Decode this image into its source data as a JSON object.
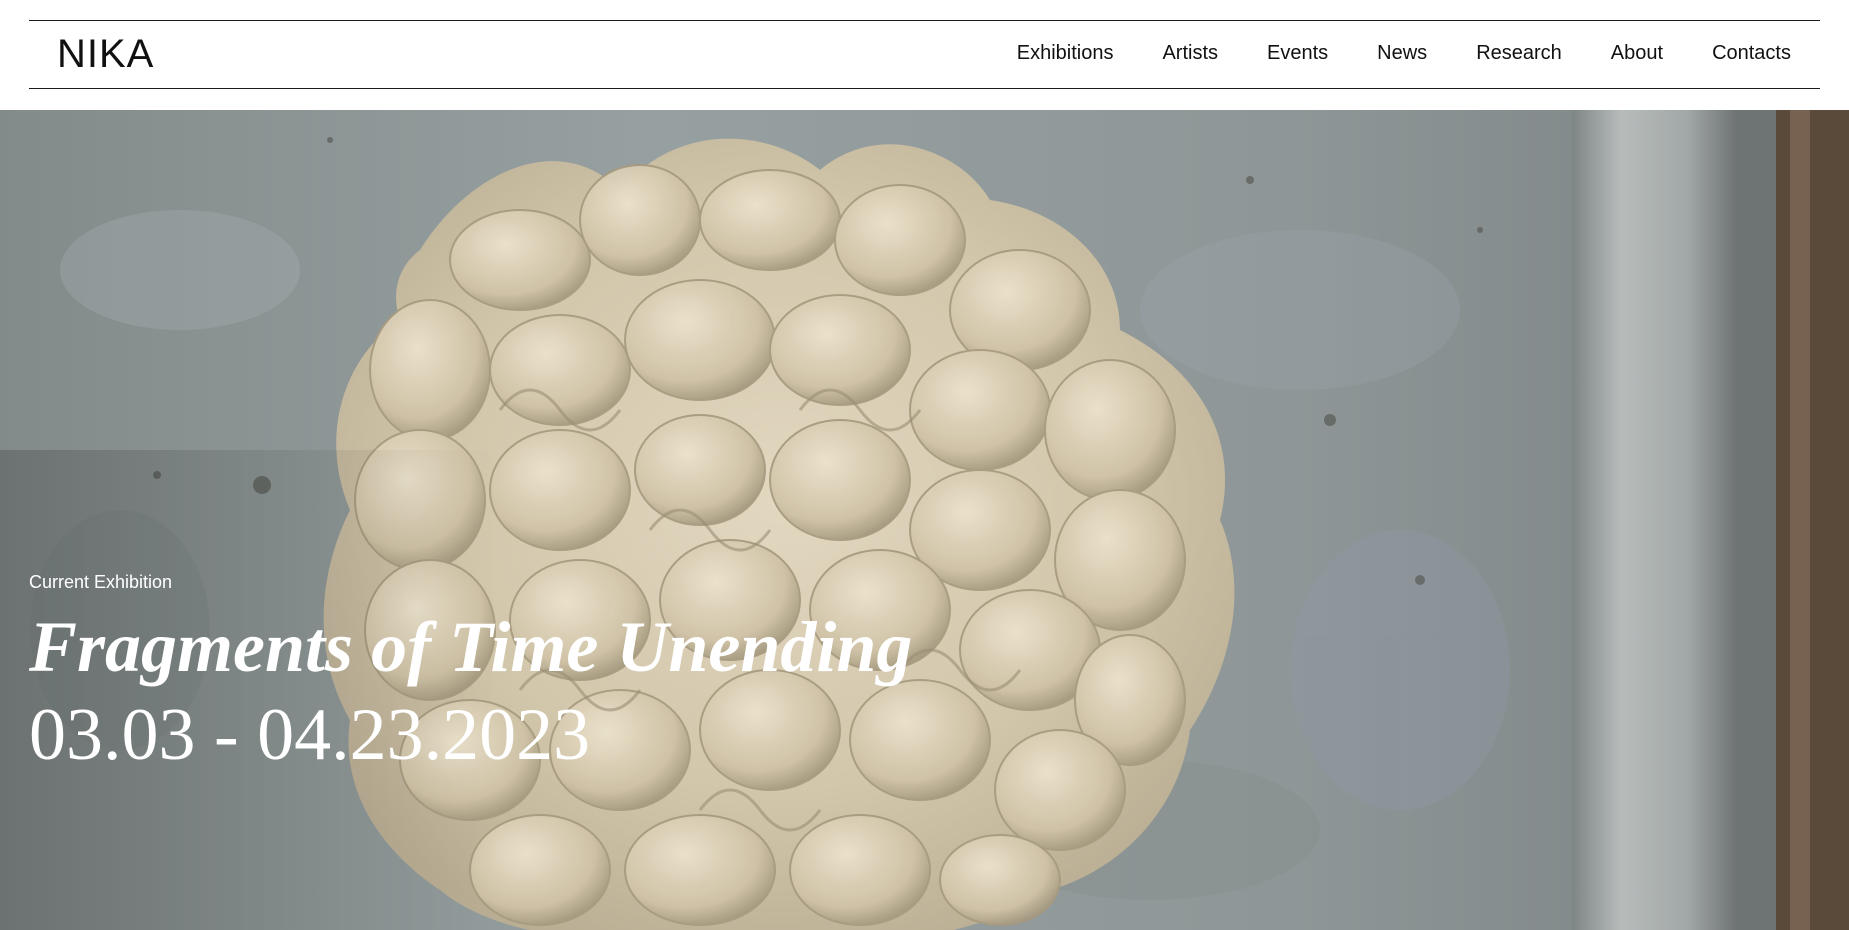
{
  "site": {
    "logo": "NIKA"
  },
  "nav": {
    "items": [
      {
        "label": "Exhibitions",
        "name": "nav-exhibitions"
      },
      {
        "label": "Artists",
        "name": "nav-artists"
      },
      {
        "label": "Events",
        "name": "nav-events"
      },
      {
        "label": "News",
        "name": "nav-news"
      },
      {
        "label": "Research",
        "name": "nav-research"
      },
      {
        "label": "About",
        "name": "nav-about"
      },
      {
        "label": "Contacts",
        "name": "nav-contacts"
      }
    ]
  },
  "hero": {
    "label": "Current Exhibition",
    "title": "Fragments of Time Unending",
    "dates": "03.03 - 04.23.2023",
    "image_subject": "crumpled-felt-textile-sculpture-on-concrete-wall"
  },
  "colors": {
    "text_dark": "#111111",
    "rule": "#1a1a1a",
    "hero_text": "#ffffff",
    "wall": "#8c9494",
    "felt": "#d8cdb4"
  }
}
